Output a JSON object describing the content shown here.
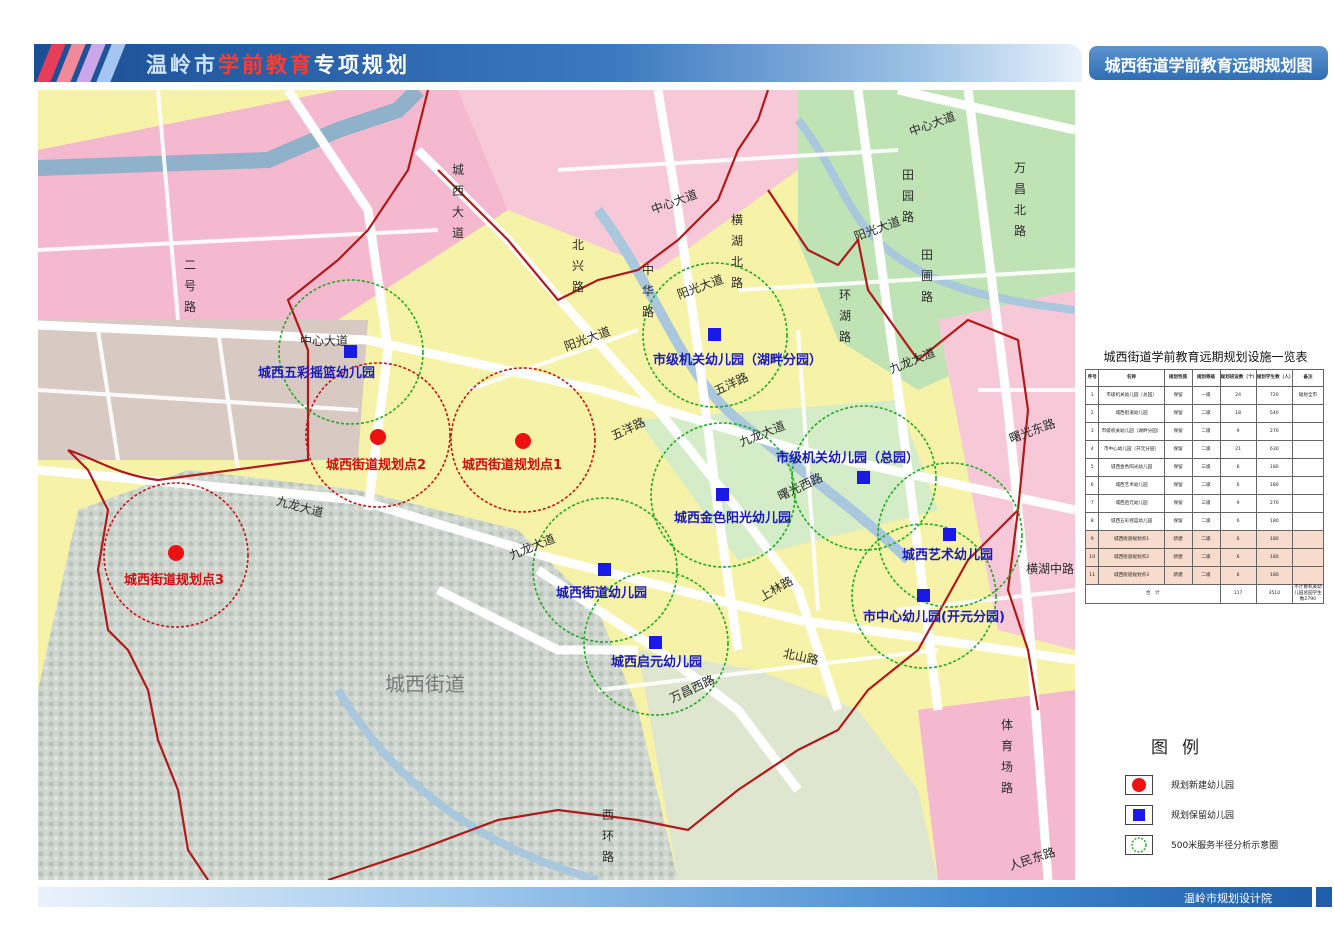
{
  "header": {
    "brand": "温岭市",
    "title_highlight": "学前教育",
    "title_suffix": "专项规划",
    "sheet_title": "城西街道学前教育远期规划图"
  },
  "map": {
    "district_label": "城西街道",
    "roads": {
      "zhongxin_dadao_top": "中心大道",
      "zhongxin_dadao_left": "中心大道",
      "zhongxin_dadao_mid": "中心大道",
      "yangguang_dadao_1": "阳光大道",
      "yangguang_dadao_2": "阳光大道",
      "yangguang_dadao_3": "阳光大道",
      "jiulong_dadao_1": "九龙大道",
      "jiulong_dadao_2": "九龙大道",
      "jiulong_dadao_3": "九龙大道",
      "jiulong_dadao_4": "九龙大道",
      "wuyang_lu_1": "五洋路",
      "wuyang_lu_2": "五洋路",
      "tiancheng_xilu": "曙光西路",
      "shuguang_donglu": "曙光东路",
      "shanglin_lu": "上林路",
      "hengxi_lu": "横湖中路",
      "renmin_donglu": "人民东路",
      "wanchang_xilu": "万昌西路",
      "beishan_lu": "北山路",
      "chengxi_dadao": "城西大道",
      "erhao_lu": "二号路",
      "beixing_lu": "北兴路",
      "zhonghua_lu": "中华路",
      "henghu_beilu": "横湖北路",
      "tianyuan_lu": "田园路",
      "wanchang_beilu": "万昌北路",
      "huanhu_lu": "环湖路",
      "tianpu_lu": "田圃路",
      "tiyuchang_lu": "体育场路",
      "xihuan_lu": "西环路"
    },
    "kindergartens": [
      {
        "label": "城西五彩摇篮幼儿园",
        "type": "retain"
      },
      {
        "label": "市级机关幼儿园（湖畔分园）",
        "type": "retain"
      },
      {
        "label": "市级机关幼儿园（总园）",
        "type": "retain"
      },
      {
        "label": "城西金色阳光幼儿园",
        "type": "retain"
      },
      {
        "label": "城西艺术幼儿园",
        "type": "retain"
      },
      {
        "label": "城西街道幼儿园",
        "type": "retain"
      },
      {
        "label": "市中心幼儿园(开元分园)",
        "type": "retain"
      },
      {
        "label": "城西启元幼儿园",
        "type": "retain"
      },
      {
        "label": "城西街道规划点1",
        "type": "new"
      },
      {
        "label": "城西街道规划点2",
        "type": "new"
      },
      {
        "label": "城西街道规划点3",
        "type": "new"
      }
    ],
    "colors": {
      "new_symbol": "#ee1111",
      "retain_symbol": "#1a1ae6",
      "service_ring": "#22aa22",
      "new_ring": "#c01818",
      "boundary": "#b01a1a"
    }
  },
  "table": {
    "title": "城西街道学前教育远期规划设施一览表",
    "headers": [
      "序号",
      "名称",
      "规划性质",
      "规划等级",
      "规划班设数（个）",
      "规划学生数（人）",
      "备注"
    ],
    "rows": [
      [
        "1",
        "市级机关幼儿园（总园）",
        "保留",
        "一级",
        "24",
        "720",
        "辐射全市"
      ],
      [
        "2",
        "城西街道幼儿园",
        "保留",
        "二级",
        "18",
        "540",
        ""
      ],
      [
        "3",
        "市级机关幼儿园（湖畔分园）",
        "保留",
        "二级",
        "9",
        "270",
        ""
      ],
      [
        "4",
        "市中心幼儿园（开元分园）",
        "保留",
        "二级",
        "21",
        "630",
        ""
      ],
      [
        "5",
        "城西金色阳光幼儿园",
        "保留",
        "三级",
        "6",
        "180",
        ""
      ],
      [
        "6",
        "城西艺术幼儿园",
        "保留",
        "二级",
        "6",
        "180",
        ""
      ],
      [
        "7",
        "城西启元幼儿园",
        "保留",
        "三级",
        "9",
        "270",
        ""
      ],
      [
        "8",
        "城西五彩摇篮幼儿园",
        "保留",
        "二级",
        "6",
        "180",
        ""
      ],
      [
        "9",
        "城西街道规划点1",
        "新建",
        "二级",
        "6",
        "180",
        ""
      ],
      [
        "10",
        "城西街道规划点2",
        "新建",
        "二级",
        "6",
        "180",
        ""
      ],
      [
        "11",
        "城西街道规划点3",
        "新建",
        "二级",
        "6",
        "180",
        ""
      ]
    ],
    "total": [
      "合　计",
      "117",
      "3510",
      "不计算机关幼儿园总园学生数2790"
    ]
  },
  "legend": {
    "title": "图例",
    "items": [
      {
        "label": "规划新建幼儿园",
        "symbol": "red-circle"
      },
      {
        "label": "规划保留幼儿园",
        "symbol": "blue-square"
      },
      {
        "label": "500米服务半径分析示意圈",
        "symbol": "green-dashed-circle"
      }
    ]
  },
  "footer": {
    "institute": "温岭市规划设计院"
  }
}
